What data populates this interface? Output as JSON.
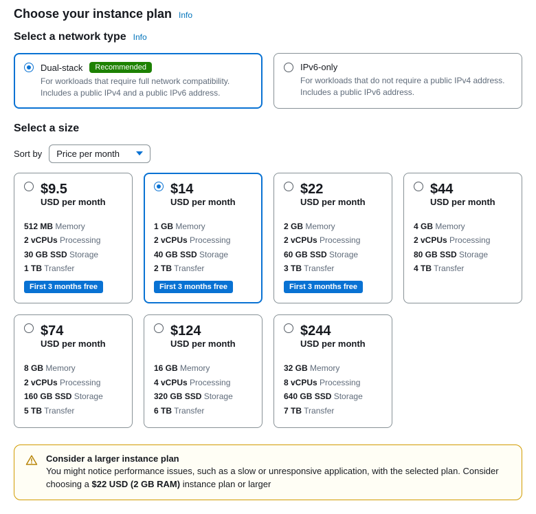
{
  "titles": {
    "choose_plan": "Choose your instance plan",
    "network_type": "Select a network type",
    "select_size": "Select a size",
    "info": "Info"
  },
  "network": {
    "options": [
      {
        "id": "dual",
        "name": "Dual-stack",
        "recommended_label": "Recommended",
        "selected": true,
        "desc": "For workloads that require full network compatibility. Includes a public IPv4 and a public IPv6 address."
      },
      {
        "id": "ipv6",
        "name": "IPv6-only",
        "recommended_label": "",
        "selected": false,
        "desc": "For workloads that do not require a public IPv4 address. Includes a public IPv6 address."
      }
    ]
  },
  "sort": {
    "label": "Sort by",
    "value": "Price per month"
  },
  "spec_labels": {
    "memory": "Memory",
    "processing": "Processing",
    "storage": "Storage",
    "transfer": "Transfer"
  },
  "plans": [
    {
      "price": "$9.5",
      "per": "USD per month",
      "memory": "512 MB",
      "cpu": "2 vCPUs",
      "storage": "30 GB SSD",
      "transfer": "1 TB",
      "promo": "First 3 months free",
      "selected": false
    },
    {
      "price": "$14",
      "per": "USD per month",
      "memory": "1 GB",
      "cpu": "2 vCPUs",
      "storage": "40 GB SSD",
      "transfer": "2 TB",
      "promo": "First 3 months free",
      "selected": true
    },
    {
      "price": "$22",
      "per": "USD per month",
      "memory": "2 GB",
      "cpu": "2 vCPUs",
      "storage": "60 GB SSD",
      "transfer": "3 TB",
      "promo": "First 3 months free",
      "selected": false
    },
    {
      "price": "$44",
      "per": "USD per month",
      "memory": "4 GB",
      "cpu": "2 vCPUs",
      "storage": "80 GB SSD",
      "transfer": "4 TB",
      "promo": "",
      "selected": false
    },
    {
      "price": "$74",
      "per": "USD per month",
      "memory": "8 GB",
      "cpu": "2 vCPUs",
      "storage": "160 GB SSD",
      "transfer": "5 TB",
      "promo": "",
      "selected": false
    },
    {
      "price": "$124",
      "per": "USD per month",
      "memory": "16 GB",
      "cpu": "4 vCPUs",
      "storage": "320 GB SSD",
      "transfer": "6 TB",
      "promo": "",
      "selected": false
    },
    {
      "price": "$244",
      "per": "USD per month",
      "memory": "32 GB",
      "cpu": "8 vCPUs",
      "storage": "640 GB SSD",
      "transfer": "7 TB",
      "promo": "",
      "selected": false
    }
  ],
  "warning": {
    "title": "Consider a larger instance plan",
    "body_pre": "You might notice performance issues, such as a slow or unresponsive application, with the selected plan. Consider choosing a ",
    "body_bold": "$22 USD (2 GB RAM)",
    "body_post": " instance plan or larger"
  }
}
